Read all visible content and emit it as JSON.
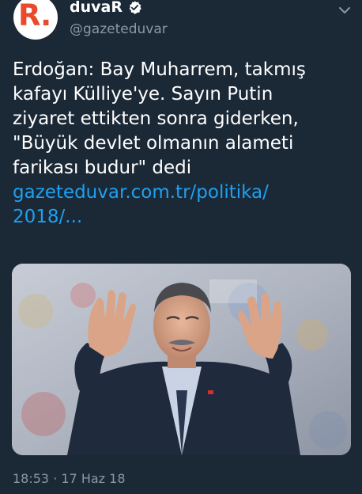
{
  "account": {
    "display_name": "duvaR",
    "handle": "@gazeteduvar",
    "avatar_mark": "R.",
    "verified": true,
    "brand_color": "#e84a2b"
  },
  "tweet": {
    "text_lines": [
      "Erdoğan: Bay Muharrem, takmış",
      "kafayı Külliye'ye. Sayın Putin",
      "ziyaret ettikten sonra giderken,",
      "\"Büyük devlet olmanın alameti",
      "farikası budur\" dedi"
    ],
    "link_lines": [
      "gazeteduvar.com.tr/politika/",
      "2018/..."
    ],
    "link_color": "#1da1f2",
    "timestamp": "18:53 · 17 Haz 18"
  },
  "media": {
    "description_icon": "photo-of-man-waving-both-hands"
  },
  "icons": {
    "verified": "verified-badge-icon",
    "menu": "chevron-down-icon"
  },
  "colors": {
    "background": "#1b2836",
    "text": "#ffffff",
    "secondary_text": "#8899a6"
  }
}
